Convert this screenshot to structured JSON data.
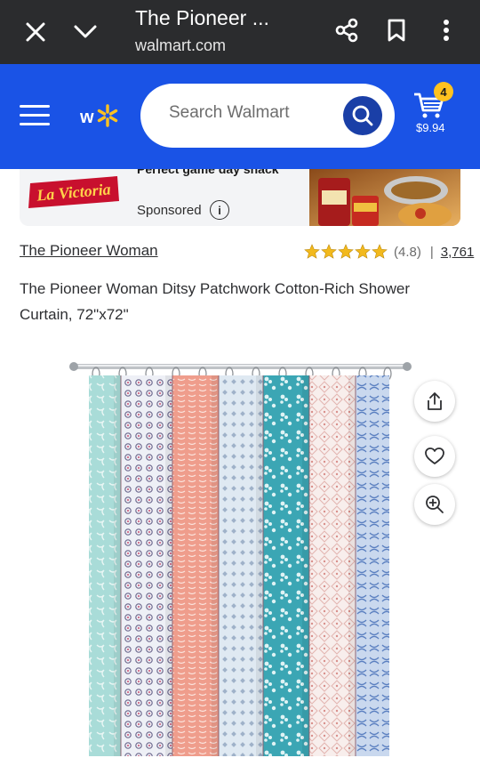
{
  "browser": {
    "title": "The Pioneer ...",
    "url": "walmart.com"
  },
  "header": {
    "search_placeholder": "Search Walmart",
    "cart_count": "4",
    "cart_total": "$9.94"
  },
  "ad": {
    "brand_logo_text": "La Victoria",
    "headline": "Perfect game day snack",
    "sponsored_label": "Sponsored",
    "info_symbol": "i"
  },
  "product": {
    "brand": "The Pioneer Woman",
    "rating": 4.8,
    "rating_text": "(4.8)",
    "separator": "|",
    "review_count": "3,761",
    "title": "The Pioneer Woman Ditsy Patchwork Cotton-Rich Shower Curtain, 72\"x72\""
  },
  "colors": {
    "browser_bar": "#2b2c2e",
    "walmart_blue": "#1a53e6",
    "search_button": "#1a3fa7",
    "spark_yellow": "#ffc220",
    "star": "#f2b91d"
  },
  "icons": {
    "close": "close-icon",
    "chevron": "chevron-down-icon",
    "share": "share-icon",
    "bookmark": "bookmark-icon",
    "more": "more-vertical-icon",
    "menu": "hamburger-menu-icon",
    "logo": "walmart-spark-icon",
    "search": "search-icon",
    "cart": "cart-icon",
    "image_share": "share-icon",
    "favorite": "heart-icon",
    "zoom": "zoom-in-icon"
  }
}
